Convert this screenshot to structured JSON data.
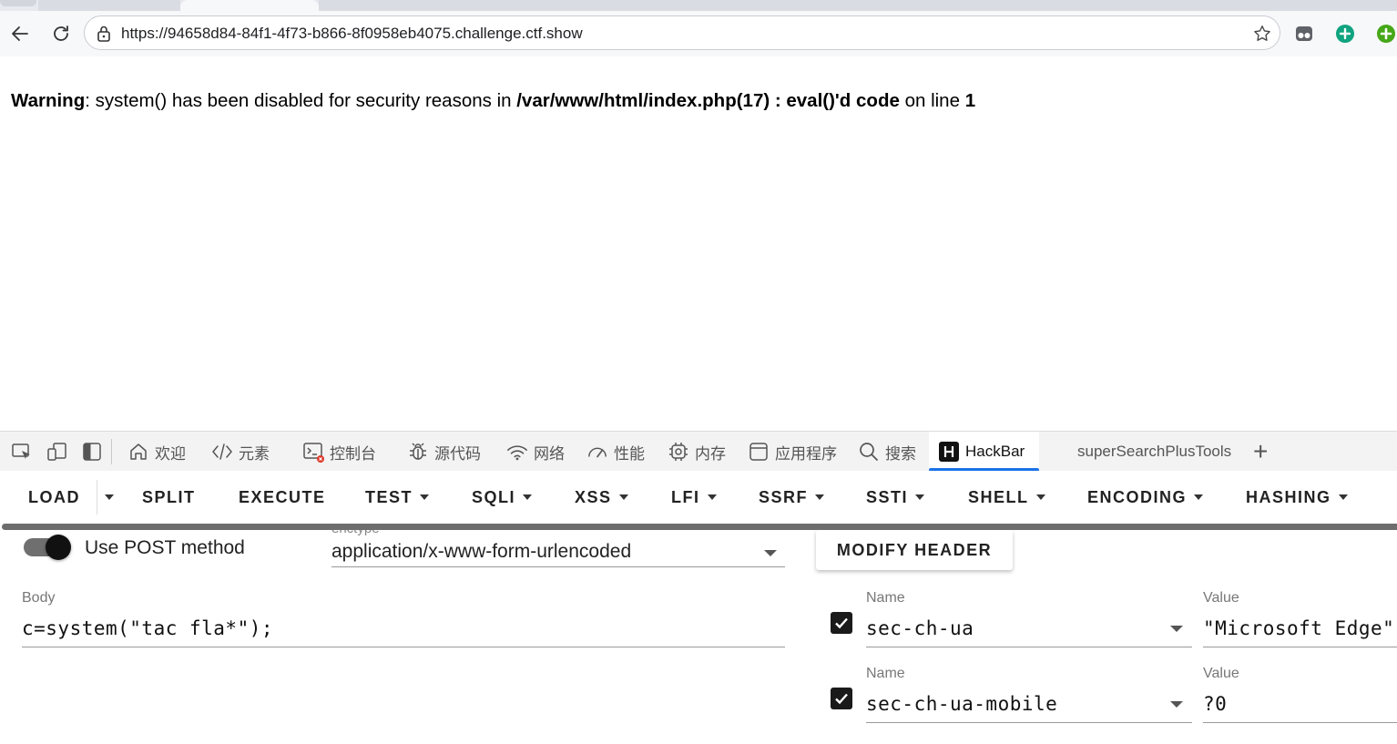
{
  "browser": {
    "url": "https://94658d84-84f1-4f73-b866-8f0958eb4075.challenge.ctf.show",
    "icons": [
      "back-arrow-icon",
      "reload-icon",
      "lock-icon",
      "star-icon",
      "extension-icon",
      "add-circle-icon",
      "green-plus-icon"
    ]
  },
  "page": {
    "warning": {
      "prefix": "Warning",
      "message": ": system() has been disabled for security reasons in ",
      "path": "/var/www/html/index.php(17) : eval()'d code",
      "on_line": " on line ",
      "line": "1"
    }
  },
  "devtools": {
    "tabs": [
      {
        "label": "欢迎",
        "icon": "home-icon"
      },
      {
        "label": "元素",
        "icon": "code-tag-icon"
      },
      {
        "label": "控制台",
        "icon": "console-icon"
      },
      {
        "label": "源代码",
        "icon": "bug-icon"
      },
      {
        "label": "网络",
        "icon": "wifi-icon"
      },
      {
        "label": "性能",
        "icon": "gauge-icon"
      },
      {
        "label": "内存",
        "icon": "chip-icon"
      },
      {
        "label": "应用程序",
        "icon": "window-icon"
      },
      {
        "label": "搜索",
        "icon": "search-icon"
      },
      {
        "label": "HackBar",
        "icon": "hackbar-logo-icon",
        "active": true
      },
      {
        "label": "superSearchPlusTools"
      }
    ],
    "add_tab": "+"
  },
  "hackbar": {
    "menu": [
      "LOAD",
      "SPLIT",
      "EXECUTE",
      "TEST",
      "SQLI",
      "XSS",
      "LFI",
      "SSRF",
      "SSTI",
      "SHELL",
      "ENCODING",
      "HASHING"
    ],
    "post_method_label": "Use POST method",
    "post_enabled": true,
    "enctype_label": "enctype",
    "enctype_value": "application/x-www-form-urlencoded",
    "modify_header_label": "MODIFY HEADER",
    "body_label": "Body",
    "body_value": "c=system(\"tac fla*\");",
    "headers": [
      {
        "name_label": "Name",
        "name": "sec-ch-ua",
        "value_label": "Value",
        "value": "\"Microsoft Edge\"",
        "checked": true
      },
      {
        "name_label": "Name",
        "name": "sec-ch-ua-mobile",
        "value_label": "Value",
        "value": "?0",
        "checked": true
      }
    ]
  },
  "colors": {
    "accent": "#1a73e8",
    "toggle_track": "#6f6f6f",
    "chrome_bg": "#f7f8fa"
  }
}
